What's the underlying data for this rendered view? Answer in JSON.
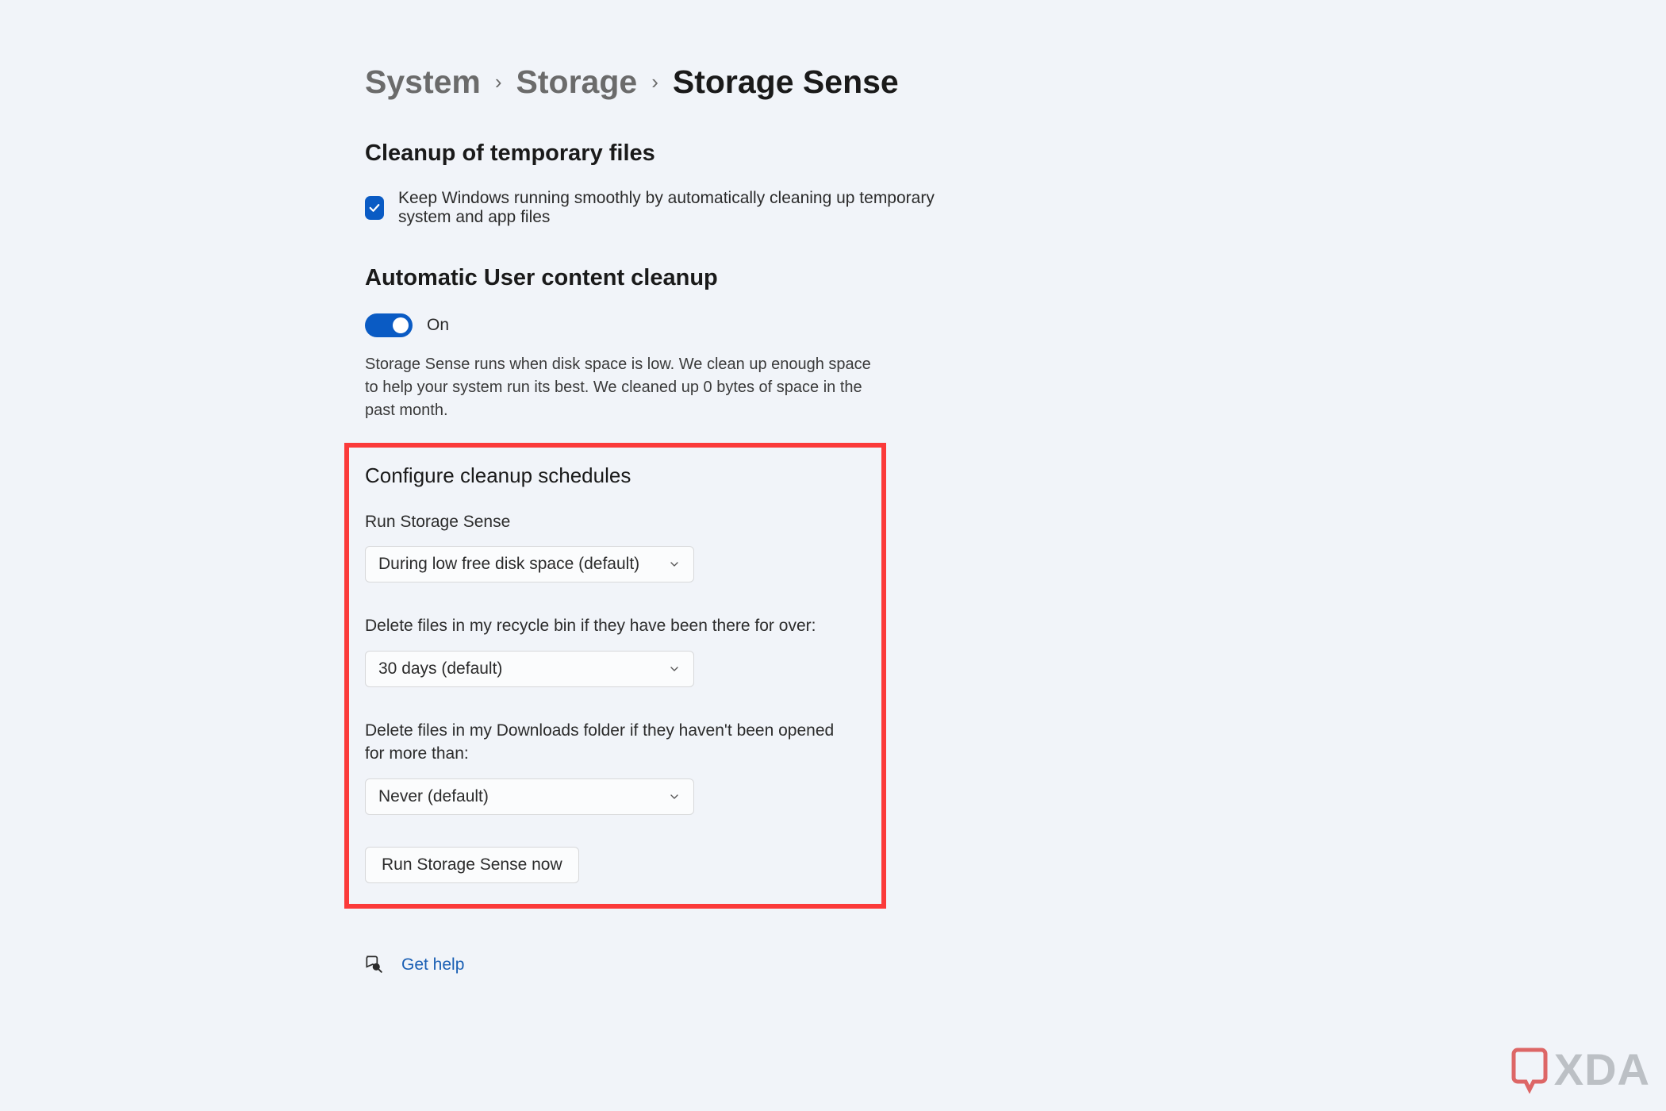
{
  "breadcrumb": {
    "level1": "System",
    "level2": "Storage",
    "level3": "Storage Sense"
  },
  "section1": {
    "title": "Cleanup of temporary files",
    "checkbox_label": "Keep Windows running smoothly by automatically cleaning up temporary system and app files"
  },
  "section2": {
    "title": "Automatic User content cleanup",
    "toggle_state": "On",
    "description": "Storage Sense runs when disk space is low. We clean up enough space to help your system run its best. We cleaned up 0 bytes of space in the past month."
  },
  "schedules": {
    "heading": "Configure cleanup schedules",
    "run_label": "Run Storage Sense",
    "run_value": "During low free disk space (default)",
    "recycle_label": "Delete files in my recycle bin if they have been there for over:",
    "recycle_value": "30 days (default)",
    "downloads_label": "Delete files in my Downloads folder if they haven't been opened for more than:",
    "downloads_value": "Never (default)",
    "run_now_button": "Run Storage Sense now"
  },
  "help": {
    "label": "Get help"
  },
  "watermark": {
    "text": "XDA"
  }
}
